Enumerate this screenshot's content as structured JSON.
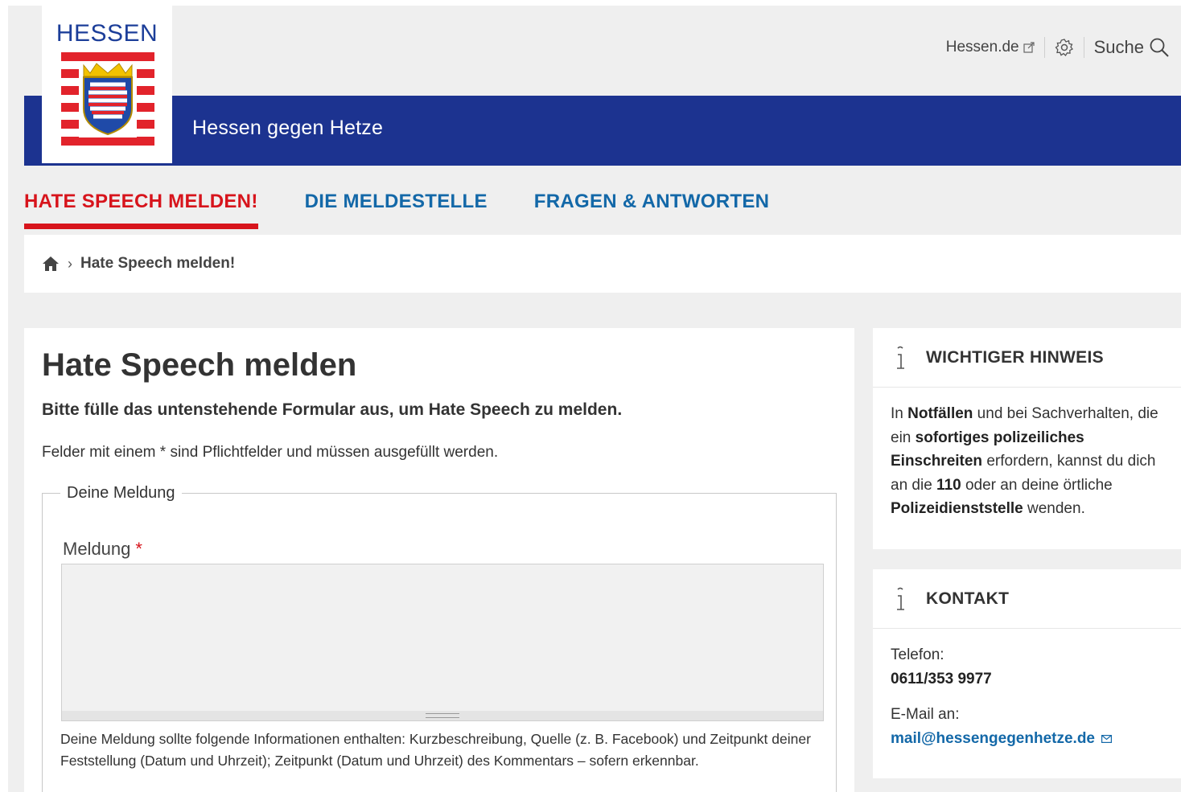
{
  "header": {
    "logo_text": "HESSEN",
    "site_title": "Hessen gegen Hetze",
    "external_link": "Hessen.de",
    "search_label": "Suche"
  },
  "nav": {
    "items": [
      {
        "label": "HATE SPEECH MELDEN!",
        "active": true
      },
      {
        "label": "DIE MELDESTELLE",
        "active": false
      },
      {
        "label": "FRAGEN & ANTWORTEN",
        "active": false
      }
    ]
  },
  "breadcrumb": {
    "separator": "›",
    "current": "Hate Speech melden!"
  },
  "main": {
    "title": "Hate Speech melden",
    "intro": "Bitte fülle das untenstehende Formular aus, um Hate Speech zu melden.",
    "required_note": "Felder mit einem * sind Pflichtfelder und müssen ausgefüllt werden.",
    "fieldset_legend": "Deine Meldung",
    "field_label": "Meldung",
    "required_marker": "*",
    "textarea_value": "",
    "help_text": "Deine Meldung sollte folgende Informationen enthalten: Kurzbeschreibung, Quelle (z. B. Facebook) und Zeitpunkt deiner Feststellung (Datum und Uhrzeit); Zeitpunkt (Datum und Uhrzeit) des Kommentars – sofern erkennbar."
  },
  "hint_panel": {
    "title": "WICHTIGER HINWEIS",
    "t1": "In ",
    "b1": "Notfällen",
    "t2": " und bei Sachverhalten, die ein ",
    "b2": "sofortiges polizeiliches Einschreiten",
    "t3": " erfordern, kannst du dich an die ",
    "b3": "110",
    "t4": " oder an deine örtliche ",
    "b4": "Polizeidienststelle",
    "t5": " wenden."
  },
  "contact_panel": {
    "title": "KONTAKT",
    "phone_label": "Telefon:",
    "phone": "0611/353 9977",
    "email_label": "E-Mail an:",
    "email": "mail@hessengegenhetze.de"
  },
  "colors": {
    "brand_blue": "#1c3390",
    "accent_red": "#d7141c",
    "link_blue": "#1368a8",
    "page_grey": "#efefef"
  },
  "icons": [
    "external-link-icon",
    "gear-icon",
    "search-icon",
    "home-icon",
    "info-icon",
    "mail-icon"
  ]
}
